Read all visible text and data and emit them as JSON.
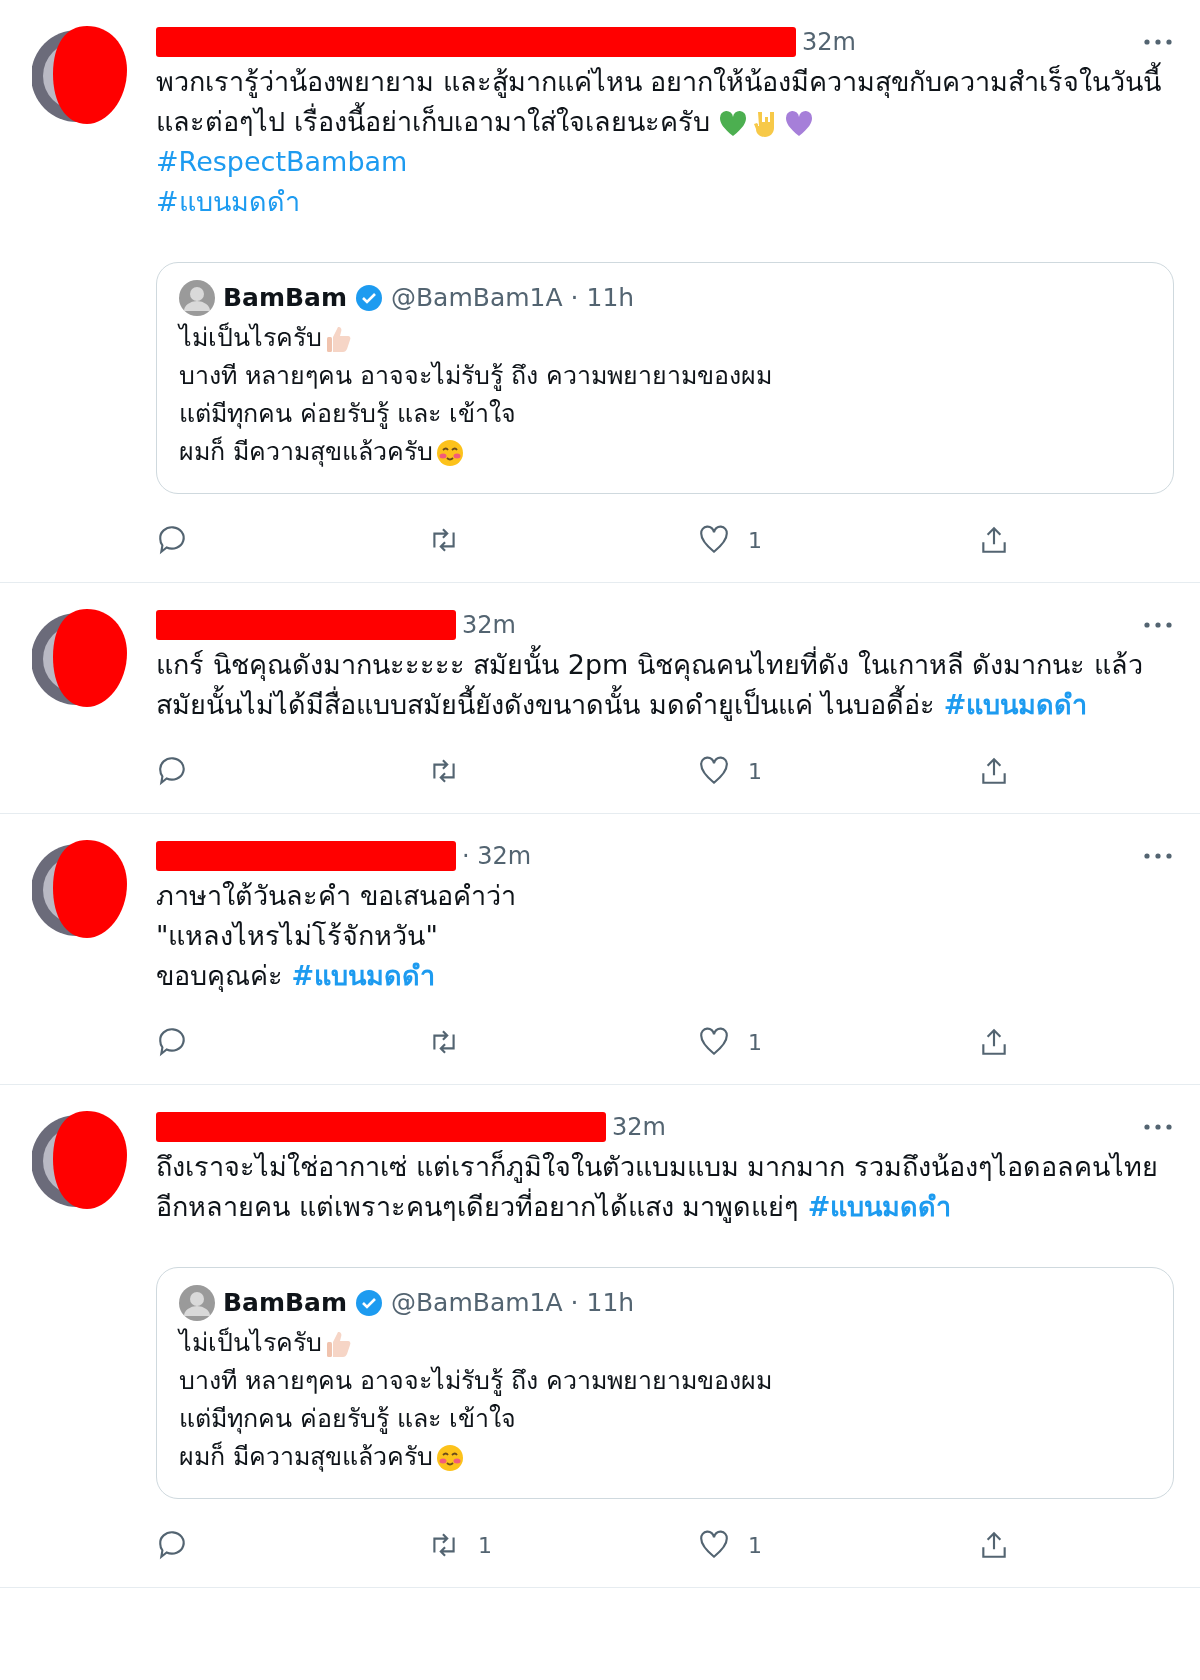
{
  "tweets": [
    {
      "redacted": true,
      "time": "32m",
      "paragraphs": [
        [
          {
            "kind": "text",
            "text": "พวกเรารู้ว่าน้องพยายาม และสู้มากแค่ไหน อยากให้น้องมีความสุขกับความสำเร็จในวันนี้และต่อๆไป เรื่องนี้อย่าเก็บเอามาใส่ใจเลยนะครับ "
          },
          {
            "kind": "heart",
            "color": "#4caf50"
          },
          {
            "kind": "hand"
          },
          {
            "kind": "heart",
            "color": "#a67fd9"
          }
        ],
        [
          {
            "kind": "hashtag",
            "text": "#RespectBambam"
          }
        ],
        [
          {
            "kind": "hashtag",
            "text": "#แบนมดดำ"
          }
        ]
      ],
      "quote": {
        "author": "BamBam",
        "verified": true,
        "handle": "@BamBam1A",
        "time": "· 11h",
        "paragraphs": [
          [
            {
              "kind": "text",
              "text": "ไม่เป็นไรครับ"
            },
            {
              "kind": "thumbs"
            }
          ],
          [
            {
              "kind": "text",
              "text": "บางที หลายๆคน อาจจะไม่รับรู้ ถึง ความพยายามของผม"
            }
          ],
          [
            {
              "kind": "text",
              "text": "แต่มีทุกคน ค่อยรับรู้ และ เข้าใจ"
            }
          ],
          [
            {
              "kind": "text",
              "text": "ผมก็ มีความสุขแล้วครับ"
            },
            {
              "kind": "blush"
            }
          ]
        ]
      },
      "actions": {
        "like_count": "1"
      }
    },
    {
      "redacted": true,
      "time": "32m",
      "paragraphs": [
        [
          {
            "kind": "text",
            "text": "แกร์ นิชคุณดังมากนะะะะะ สมัยนั้น 2pm นิชคุณคนไทยที่ดัง ในเกาหลี ดังมากนะ แล้วสมัยนั้นไม่ได้มีสื่อแบบสมัยนี้ยังดังขนาดนั้น มดดำยูเป็นแค่ ไนบอดี้อ่ะ "
          },
          {
            "kind": "hashtag",
            "text": "#แบนมดดำ"
          }
        ]
      ],
      "actions": {
        "like_count": "1"
      }
    },
    {
      "redacted": true,
      "time": "· 32m",
      "paragraphs": [
        [
          {
            "kind": "text",
            "text": "ภาษาใต้วันละคำ ขอเสนอคำว่า"
          }
        ],
        [
          {
            "kind": "text",
            "text": "\"แหลงไหรไม่โร้จักหวัน\""
          }
        ],
        [
          {
            "kind": "text",
            "text": " ขอบคุณค่ะ  "
          },
          {
            "kind": "hashtag",
            "text": "#แบนมดดำ"
          }
        ]
      ],
      "actions": {
        "like_count": "1"
      }
    },
    {
      "redacted": true,
      "time": "32m",
      "paragraphs": [
        [
          {
            "kind": "text",
            "text": "ถึงเราจะไม่ใช่อากาเซ่ แต่เราก็ภูมิใจในตัวแบมแบม มากมาก รวมถึงน้องๆไอดอลคนไทยอีกหลายคน แต่เพราะคนๆเดียวที่อยากได้แสง มาพูดแย่ๆ "
          },
          {
            "kind": "hashtag",
            "text": "#แบนมดดำ"
          }
        ]
      ],
      "quote": {
        "author": "BamBam",
        "verified": true,
        "handle": "@BamBam1A",
        "time": "· 11h",
        "paragraphs": [
          [
            {
              "kind": "text",
              "text": "ไม่เป็นไรครับ"
            },
            {
              "kind": "thumbs"
            }
          ],
          [
            {
              "kind": "text",
              "text": "บางที หลายๆคน อาจจะไม่รับรู้ ถึง ความพยายามของผม"
            }
          ],
          [
            {
              "kind": "text",
              "text": "แต่มีทุกคน ค่อยรับรู้ และ เข้าใจ"
            }
          ],
          [
            {
              "kind": "text",
              "text": "ผมก็ มีความสุขแล้วครับ"
            },
            {
              "kind": "blush"
            }
          ]
        ]
      },
      "actions": {
        "retweet_count": "1",
        "like_count": "1"
      }
    }
  ]
}
